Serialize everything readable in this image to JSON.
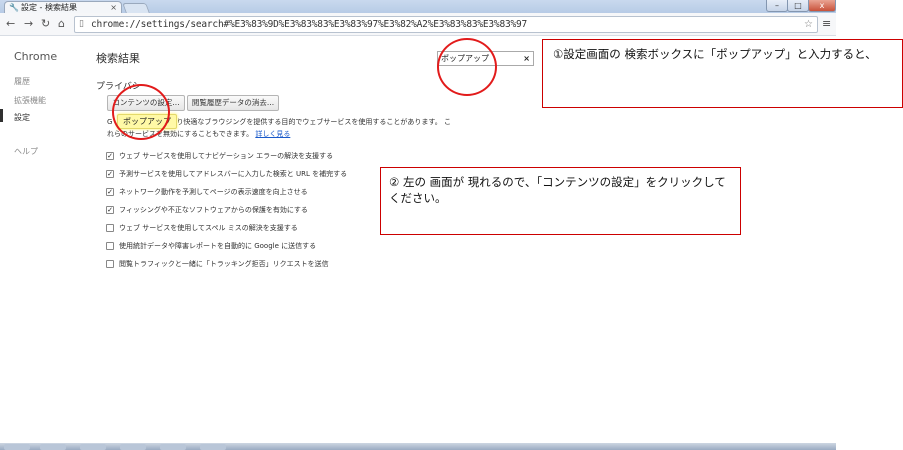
{
  "browser": {
    "tab_title": "設定 - 検索結果",
    "tab_icon": "wrench-icon",
    "url": "chrome://settings/search#%E3%83%9D%E3%83%83%E3%83%97%E3%82%A2%E3%83%83%E3%83%97",
    "window_buttons": {
      "minimize": "–",
      "maximize": "□",
      "close": "x"
    }
  },
  "sidebar": {
    "brand": "Chrome",
    "items": [
      {
        "label": "履歴"
      },
      {
        "label": "拡張機能"
      },
      {
        "label": "設定",
        "active": true
      },
      {
        "label": "ヘルプ"
      }
    ]
  },
  "main": {
    "page_title": "検索結果",
    "search_value": "ポップアップ",
    "search_clear": "×",
    "section_title": "プライバシー",
    "buttons": {
      "content_settings": "コンテンツの設定...",
      "clear_data": "閲覧履歴データの消去..."
    },
    "tooltip": "ポップアップ",
    "desc_line1_pre": "G",
    "desc_line1": "り快適なブラウジングを提供する目的でウェブサービスを使用することがあります。 こ",
    "desc_line2": "れらのサービスを無効にすることもできます。",
    "desc_link": "詳しく見る",
    "options": [
      {
        "label": "ウェブ サービスを使用してナビゲーション エラーの解決を支援する",
        "checked": true
      },
      {
        "label": "予測サービスを使用してアドレスバーに入力した検索と URL を補完する",
        "checked": true
      },
      {
        "label": "ネットワーク動作を予測してページの表示速度を向上させる",
        "checked": true
      },
      {
        "label": "フィッシングや不正なソフトウェアからの保護を有効にする",
        "checked": true
      },
      {
        "label": "ウェブ サービスを使用してスペル ミスの解決を支援する",
        "checked": false
      },
      {
        "label": "使用統計データや障害レポートを自動的に Google に送信する",
        "checked": false
      },
      {
        "label": "閲覧トラフィックと一緒に「トラッキング拒否」リクエストを送信",
        "checked": false
      }
    ]
  },
  "annotations": {
    "note1": "①設定画面の 検索ボックスに「ポップアップ」と入力すると、",
    "note2": "② 左の 画面が 現れるので、「コンテンツの設定」をクリックしてください。",
    "color": "#e21b1b"
  }
}
